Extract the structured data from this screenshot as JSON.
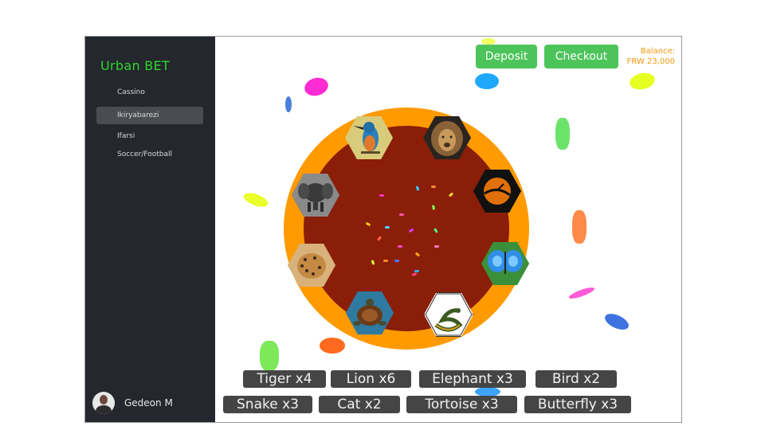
{
  "brand": "Urban BET",
  "nav": [
    {
      "label": "Cassino",
      "active": false
    },
    {
      "label": "Ikiryabarezi",
      "active": true
    },
    {
      "label": "Ifarsi",
      "active": false
    },
    {
      "label": "Soccer/Football",
      "active": false
    }
  ],
  "user": {
    "name": "Gedeon M"
  },
  "header": {
    "deposit_label": "Deposit",
    "checkout_label": "Checkout",
    "balance_label": "Balance:",
    "balance_value": "FRW 23,000"
  },
  "wheel": {
    "segments": [
      {
        "animal": "bird",
        "icon": "kingfisher-bird-icon"
      },
      {
        "animal": "lion",
        "icon": "lion-icon"
      },
      {
        "animal": "bird",
        "icon": "bird-sunset-icon"
      },
      {
        "animal": "butterfly",
        "icon": "butterfly-icon"
      },
      {
        "animal": "snake",
        "icon": "snake-icon"
      },
      {
        "animal": "tortoise",
        "icon": "tortoise-icon"
      },
      {
        "animal": "tiger",
        "icon": "leopard-icon"
      },
      {
        "animal": "elephant",
        "icon": "elephant-icon"
      }
    ]
  },
  "bets": [
    {
      "label": "Tiger x4"
    },
    {
      "label": "Lion x6"
    },
    {
      "label": "Elephant x3"
    },
    {
      "label": "Bird x2"
    },
    {
      "label": "Snake x3"
    },
    {
      "label": "Cat x2"
    },
    {
      "label": "Tortoise x3"
    },
    {
      "label": "Butterfly x3"
    }
  ],
  "colors": {
    "brand": "#2bd82b",
    "accent_button": "#4cc45a",
    "balance": "#f0980c",
    "wheel_outer": "#ff9a00",
    "wheel_inner": "#8b1e08",
    "sidebar": "#24272d"
  }
}
